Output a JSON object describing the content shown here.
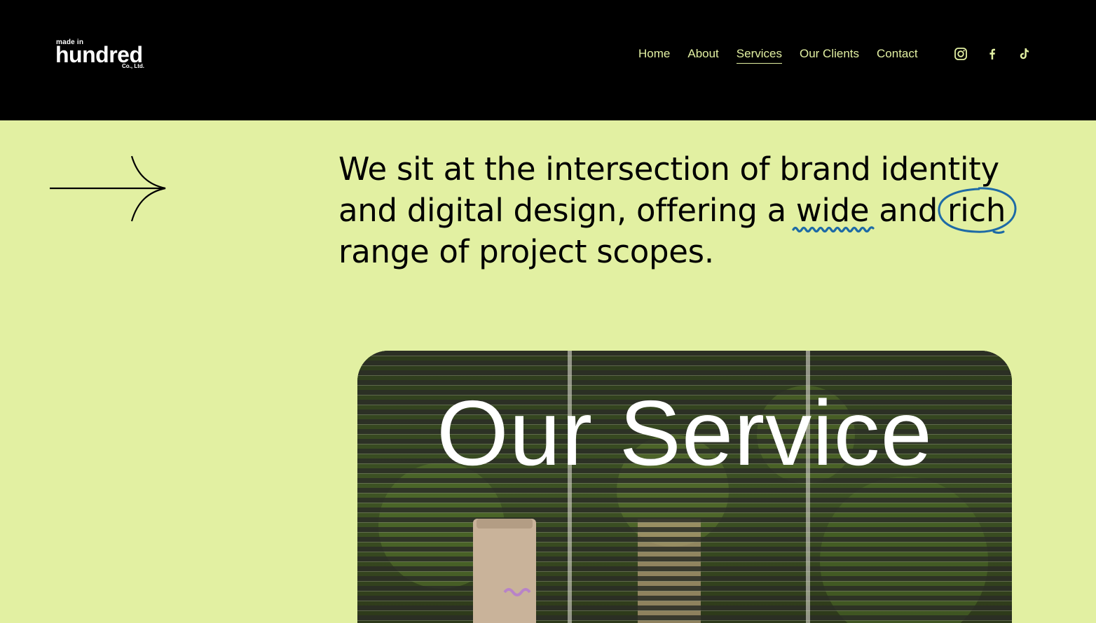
{
  "header": {
    "logo": {
      "line1": "made in",
      "line2": "hundred",
      "line3": "Co., Ltd."
    },
    "nav": [
      {
        "label": "Home",
        "active": false
      },
      {
        "label": "About",
        "active": false
      },
      {
        "label": "Services",
        "active": true
      },
      {
        "label": "Our Clients",
        "active": false
      },
      {
        "label": "Contact",
        "active": false
      }
    ],
    "social": [
      "instagram-icon",
      "facebook-icon",
      "tiktok-icon"
    ]
  },
  "hero": {
    "line1": "We sit at the intersection of brand identity",
    "line2_pre": "and digital design, offering a ",
    "word_wide": "wide",
    "line2_mid": " and ",
    "word_rich": "rich",
    "line3": "range of project scopes.",
    "annotation_color": "#1d6aa6"
  },
  "card": {
    "title": "Our Service"
  },
  "colors": {
    "background": "#e2f0a2",
    "header": "#000000",
    "nav_text": "#e2f0a2"
  }
}
